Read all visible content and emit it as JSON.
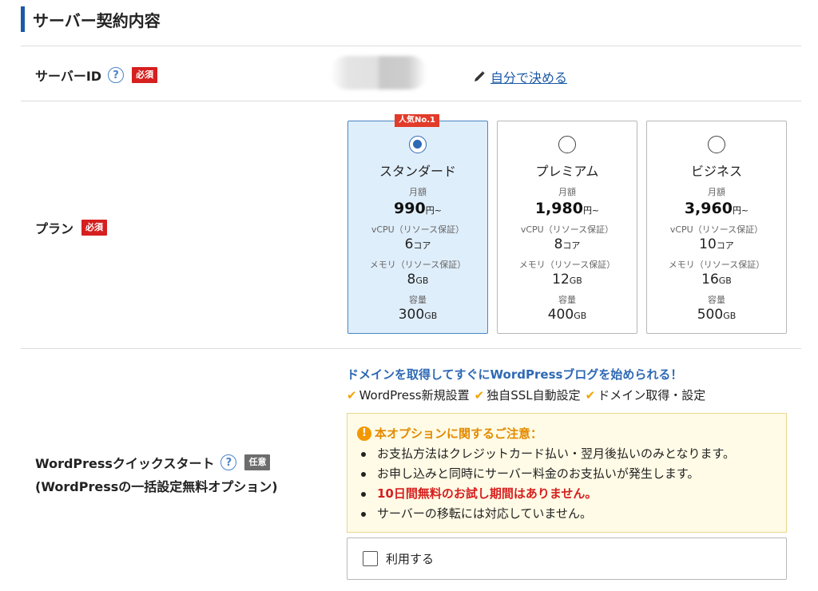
{
  "section": {
    "title": "サーバー契約内容"
  },
  "server_id": {
    "label": "サーバーID",
    "help_icon": "question-circle-icon",
    "required_badge": "必須",
    "edit_link": "自分で決める",
    "edit_icon": "pencil-icon"
  },
  "plan": {
    "label": "プラン",
    "required_badge": "必須",
    "popular_badge": "人気No.1",
    "cards": [
      {
        "name": "スタンダード",
        "price_label": "月額",
        "price": "990",
        "price_unit": "円~",
        "cpu_label": "vCPU（リソース保証）",
        "cpu": "6",
        "cpu_unit": "コア",
        "mem_label": "メモリ（リソース保証）",
        "mem": "8",
        "mem_unit": "GB",
        "disk_label": "容量",
        "disk": "300",
        "disk_unit": "GB",
        "selected": true
      },
      {
        "name": "プレミアム",
        "price_label": "月額",
        "price": "1,980",
        "price_unit": "円~",
        "cpu_label": "vCPU（リソース保証）",
        "cpu": "8",
        "cpu_unit": "コア",
        "mem_label": "メモリ（リソース保証）",
        "mem": "12",
        "mem_unit": "GB",
        "disk_label": "容量",
        "disk": "400",
        "disk_unit": "GB",
        "selected": false
      },
      {
        "name": "ビジネス",
        "price_label": "月額",
        "price": "3,960",
        "price_unit": "円~",
        "cpu_label": "vCPU（リソース保証）",
        "cpu": "10",
        "cpu_unit": "コア",
        "mem_label": "メモリ（リソース保証）",
        "mem": "16",
        "mem_unit": "GB",
        "disk_label": "容量",
        "disk": "500",
        "disk_unit": "GB",
        "selected": false
      }
    ]
  },
  "wordpress": {
    "label_line1": "WordPressクイックスタート",
    "label_line2": "(WordPressの一括設定無料オプション)",
    "optional_badge": "任意",
    "headline": "ドメインを取得してすぐにWordPressブログを始められる！",
    "features": [
      "WordPress新規設置",
      "独自SSL自動設定",
      "ドメイン取得・設定"
    ],
    "notice_title": "本オプションに関するご注意：",
    "notices": [
      "お支払方法はクレジットカード払い・翌月後払いのみとなります。",
      "お申し込みと同時にサーバー料金のお支払いが発生します。",
      "10日間無料のお試し期間はありません。",
      "サーバーの移転には対応していません。"
    ],
    "use_label": "利用する",
    "use_checked": false
  },
  "colors": {
    "accent": "#1a5aa6",
    "required": "#d61f1f",
    "warning": "#f39800",
    "selected_bg": "#dfeefb"
  }
}
